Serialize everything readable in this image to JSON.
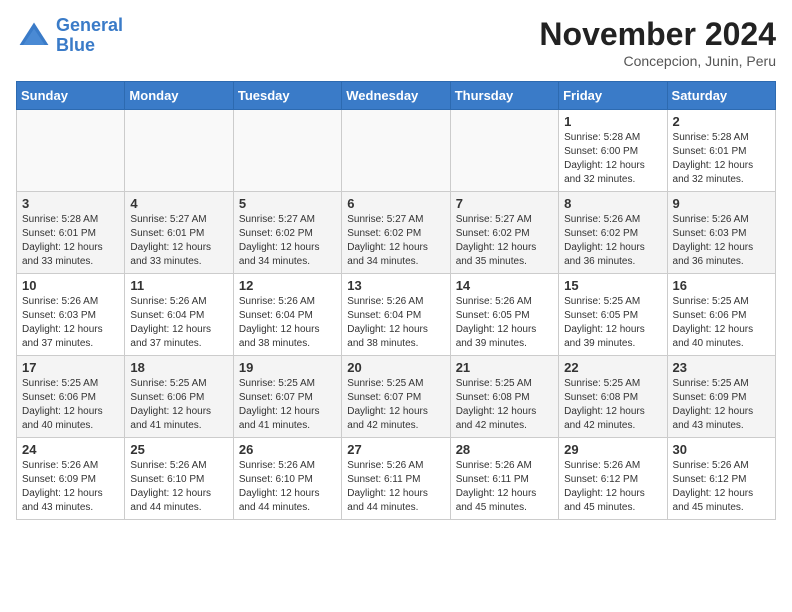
{
  "header": {
    "logo_line1": "General",
    "logo_line2": "Blue",
    "month": "November 2024",
    "location": "Concepcion, Junin, Peru"
  },
  "weekdays": [
    "Sunday",
    "Monday",
    "Tuesday",
    "Wednesday",
    "Thursday",
    "Friday",
    "Saturday"
  ],
  "weeks": [
    [
      {
        "day": "",
        "info": ""
      },
      {
        "day": "",
        "info": ""
      },
      {
        "day": "",
        "info": ""
      },
      {
        "day": "",
        "info": ""
      },
      {
        "day": "",
        "info": ""
      },
      {
        "day": "1",
        "info": "Sunrise: 5:28 AM\nSunset: 6:00 PM\nDaylight: 12 hours\nand 32 minutes."
      },
      {
        "day": "2",
        "info": "Sunrise: 5:28 AM\nSunset: 6:01 PM\nDaylight: 12 hours\nand 32 minutes."
      }
    ],
    [
      {
        "day": "3",
        "info": "Sunrise: 5:28 AM\nSunset: 6:01 PM\nDaylight: 12 hours\nand 33 minutes."
      },
      {
        "day": "4",
        "info": "Sunrise: 5:27 AM\nSunset: 6:01 PM\nDaylight: 12 hours\nand 33 minutes."
      },
      {
        "day": "5",
        "info": "Sunrise: 5:27 AM\nSunset: 6:02 PM\nDaylight: 12 hours\nand 34 minutes."
      },
      {
        "day": "6",
        "info": "Sunrise: 5:27 AM\nSunset: 6:02 PM\nDaylight: 12 hours\nand 34 minutes."
      },
      {
        "day": "7",
        "info": "Sunrise: 5:27 AM\nSunset: 6:02 PM\nDaylight: 12 hours\nand 35 minutes."
      },
      {
        "day": "8",
        "info": "Sunrise: 5:26 AM\nSunset: 6:02 PM\nDaylight: 12 hours\nand 36 minutes."
      },
      {
        "day": "9",
        "info": "Sunrise: 5:26 AM\nSunset: 6:03 PM\nDaylight: 12 hours\nand 36 minutes."
      }
    ],
    [
      {
        "day": "10",
        "info": "Sunrise: 5:26 AM\nSunset: 6:03 PM\nDaylight: 12 hours\nand 37 minutes."
      },
      {
        "day": "11",
        "info": "Sunrise: 5:26 AM\nSunset: 6:04 PM\nDaylight: 12 hours\nand 37 minutes."
      },
      {
        "day": "12",
        "info": "Sunrise: 5:26 AM\nSunset: 6:04 PM\nDaylight: 12 hours\nand 38 minutes."
      },
      {
        "day": "13",
        "info": "Sunrise: 5:26 AM\nSunset: 6:04 PM\nDaylight: 12 hours\nand 38 minutes."
      },
      {
        "day": "14",
        "info": "Sunrise: 5:26 AM\nSunset: 6:05 PM\nDaylight: 12 hours\nand 39 minutes."
      },
      {
        "day": "15",
        "info": "Sunrise: 5:25 AM\nSunset: 6:05 PM\nDaylight: 12 hours\nand 39 minutes."
      },
      {
        "day": "16",
        "info": "Sunrise: 5:25 AM\nSunset: 6:06 PM\nDaylight: 12 hours\nand 40 minutes."
      }
    ],
    [
      {
        "day": "17",
        "info": "Sunrise: 5:25 AM\nSunset: 6:06 PM\nDaylight: 12 hours\nand 40 minutes."
      },
      {
        "day": "18",
        "info": "Sunrise: 5:25 AM\nSunset: 6:06 PM\nDaylight: 12 hours\nand 41 minutes."
      },
      {
        "day": "19",
        "info": "Sunrise: 5:25 AM\nSunset: 6:07 PM\nDaylight: 12 hours\nand 41 minutes."
      },
      {
        "day": "20",
        "info": "Sunrise: 5:25 AM\nSunset: 6:07 PM\nDaylight: 12 hours\nand 42 minutes."
      },
      {
        "day": "21",
        "info": "Sunrise: 5:25 AM\nSunset: 6:08 PM\nDaylight: 12 hours\nand 42 minutes."
      },
      {
        "day": "22",
        "info": "Sunrise: 5:25 AM\nSunset: 6:08 PM\nDaylight: 12 hours\nand 42 minutes."
      },
      {
        "day": "23",
        "info": "Sunrise: 5:25 AM\nSunset: 6:09 PM\nDaylight: 12 hours\nand 43 minutes."
      }
    ],
    [
      {
        "day": "24",
        "info": "Sunrise: 5:26 AM\nSunset: 6:09 PM\nDaylight: 12 hours\nand 43 minutes."
      },
      {
        "day": "25",
        "info": "Sunrise: 5:26 AM\nSunset: 6:10 PM\nDaylight: 12 hours\nand 44 minutes."
      },
      {
        "day": "26",
        "info": "Sunrise: 5:26 AM\nSunset: 6:10 PM\nDaylight: 12 hours\nand 44 minutes."
      },
      {
        "day": "27",
        "info": "Sunrise: 5:26 AM\nSunset: 6:11 PM\nDaylight: 12 hours\nand 44 minutes."
      },
      {
        "day": "28",
        "info": "Sunrise: 5:26 AM\nSunset: 6:11 PM\nDaylight: 12 hours\nand 45 minutes."
      },
      {
        "day": "29",
        "info": "Sunrise: 5:26 AM\nSunset: 6:12 PM\nDaylight: 12 hours\nand 45 minutes."
      },
      {
        "day": "30",
        "info": "Sunrise: 5:26 AM\nSunset: 6:12 PM\nDaylight: 12 hours\nand 45 minutes."
      }
    ]
  ]
}
